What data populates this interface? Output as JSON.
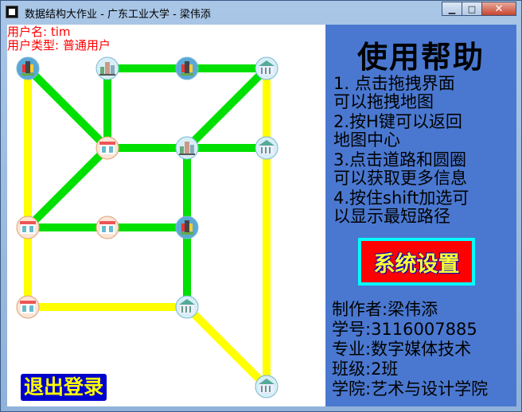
{
  "window": {
    "title": "数据结构大作业 - 广东工业大学 - 梁伟添",
    "minimize_glyph": "▁",
    "maximize_glyph": "□",
    "close_glyph": "✕"
  },
  "user": {
    "name_line": "用户名:  tim",
    "type_line": "用户类型:  普通用户"
  },
  "logout_label": "退出登录",
  "help": {
    "title": "使用帮助",
    "lines": [
      "1. 点击拖拽界面",
      "    可以拖拽地图",
      "2.按H键可以返回",
      "    地图中心",
      "3.点击道路和圆圈",
      "    可以获取更多信息",
      "4.按住shift加选可",
      "    以显示最短路径"
    ]
  },
  "settings_label": "系统设置",
  "credits": [
    "制作者:梁伟添",
    "学号:3116007885",
    "专业:数字媒体技术",
    "班级:2班",
    "学院:艺术与设计学院"
  ],
  "colors": {
    "road_green": "#00e000",
    "road_yellow": "#ffff00",
    "panel_blue": "#4a78d0",
    "user_text_red": "#ff0000"
  },
  "map": {
    "nodes": [
      {
        "id": "n1",
        "icon": "castle-node-icon"
      },
      {
        "id": "n2",
        "icon": "city-node-icon"
      },
      {
        "id": "n3",
        "icon": "castle-node-icon"
      },
      {
        "id": "n4",
        "icon": "building-node-icon"
      },
      {
        "id": "n5",
        "icon": "shop-node-icon"
      },
      {
        "id": "n6",
        "icon": "city-node-icon"
      },
      {
        "id": "n7",
        "icon": "building-node-icon"
      },
      {
        "id": "n8",
        "icon": "shop-node-icon"
      },
      {
        "id": "n9",
        "icon": "shop-node-icon"
      },
      {
        "id": "n10",
        "icon": "castle-node-icon"
      },
      {
        "id": "n11",
        "icon": "shop-node-icon"
      },
      {
        "id": "n12",
        "icon": "building-node-icon"
      },
      {
        "id": "n13",
        "icon": "building-node-icon"
      }
    ],
    "roads": [
      {
        "from": "n1",
        "to": "n5",
        "type": "green"
      },
      {
        "from": "n1",
        "to": "n8",
        "type": "yellow"
      },
      {
        "from": "n2",
        "to": "n3",
        "type": "green"
      },
      {
        "from": "n2",
        "to": "n5",
        "type": "green"
      },
      {
        "from": "n3",
        "to": "n4",
        "type": "green"
      },
      {
        "from": "n4",
        "to": "n6",
        "type": "green"
      },
      {
        "from": "n4",
        "to": "n7",
        "type": "yellow"
      },
      {
        "from": "n5",
        "to": "n6",
        "type": "green"
      },
      {
        "from": "n5",
        "to": "n8",
        "type": "green"
      },
      {
        "from": "n6",
        "to": "n7",
        "type": "green"
      },
      {
        "from": "n6",
        "to": "n10",
        "type": "green"
      },
      {
        "from": "n7",
        "to": "n13",
        "type": "yellow"
      },
      {
        "from": "n8",
        "to": "n9",
        "type": "green"
      },
      {
        "from": "n8",
        "to": "n11",
        "type": "yellow"
      },
      {
        "from": "n9",
        "to": "n10",
        "type": "green"
      },
      {
        "from": "n10",
        "to": "n12",
        "type": "green"
      },
      {
        "from": "n11",
        "to": "n12",
        "type": "yellow"
      },
      {
        "from": "n12",
        "to": "n13",
        "type": "yellow"
      }
    ]
  }
}
